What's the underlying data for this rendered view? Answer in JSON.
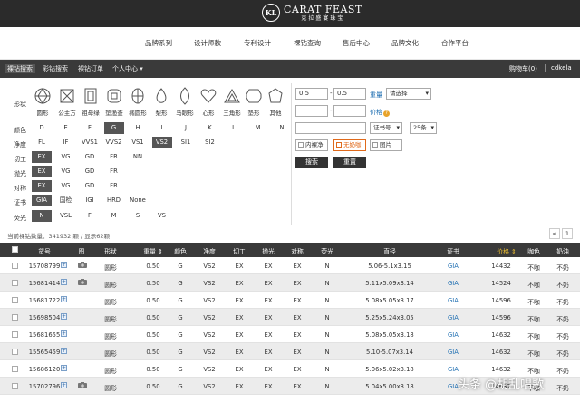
{
  "brand": {
    "name": "CARAT FEAST",
    "name_cn": "克拉盛宴珠宝",
    "mark": "KL"
  },
  "main_nav": [
    "品牌系列",
    "设计师款",
    "专利设计",
    "裸钻查询",
    "售后中心",
    "品牌文化",
    "合作平台"
  ],
  "sub_nav": {
    "items": [
      "裸钻搜索",
      "彩钻搜索",
      "裸钻订单",
      "个人中心 ▾"
    ],
    "active": 0,
    "cart": "购物车(0)",
    "user": "cdkela"
  },
  "filters": {
    "shape_label": "形状",
    "shapes": [
      "圆形",
      "公主方",
      "祖母绿",
      "垫渔查",
      "椭圆形",
      "梨形",
      "马眼形",
      "心形",
      "三角形",
      "垫形",
      "其他"
    ],
    "color_label": "颜色",
    "colors": [
      "D",
      "E",
      "F",
      "G",
      "H",
      "I",
      "J",
      "K",
      "L",
      "M",
      "N"
    ],
    "color_selected": "G",
    "clarity_label": "净度",
    "clarity": [
      "FL",
      "IF",
      "VVS1",
      "VVS2",
      "VS1",
      "VS2",
      "SI1",
      "SI2"
    ],
    "clarity_selected": "VS2",
    "cut_label": "切工",
    "cut": [
      "EX",
      "VG",
      "GD",
      "FR",
      "NN"
    ],
    "polish_label": "抛光",
    "polish": [
      "EX",
      "VG",
      "GD",
      "FR"
    ],
    "symmetry_label": "对称",
    "symmetry": [
      "EX",
      "VG",
      "GD",
      "FR"
    ],
    "cert_label": "证书",
    "cert": [
      "GIA",
      "国检",
      "IGI",
      "HRD",
      "None"
    ],
    "fluor_label": "荧光",
    "fluor": [
      "N",
      "VSL",
      "F",
      "M",
      "S",
      "VS"
    ]
  },
  "search": {
    "weight_min": "0.5",
    "weight_max": "0.5",
    "weight_label": "重量",
    "weight_select": "请选择",
    "price_min": "",
    "price_max": "",
    "price_label": "价格",
    "cert_no_value": "",
    "cert_no_select": "证书号",
    "per_page_select": "25条",
    "checkboxes": [
      {
        "label": "内裸净",
        "checked": false
      },
      {
        "label": "无奶咖",
        "checked": true
      },
      {
        "label": "图片",
        "checked": false
      }
    ],
    "search_button": "搜索",
    "reset_button": "重置"
  },
  "results": {
    "info": "当前裸钻数量：341932 颗 / 显示62颗",
    "pages": [
      "<",
      "1"
    ]
  },
  "table": {
    "headers": [
      "货号",
      "图",
      "形状",
      "重量 ⇕",
      "颜色",
      "净度",
      "切工",
      "抛光",
      "对称",
      "荧光",
      "直径",
      "证书",
      "价格 ⇕",
      "咖色",
      "奶油"
    ],
    "rows": [
      [
        "15708799",
        "圆形",
        "0.50",
        "G",
        "VS2",
        "EX",
        "EX",
        "EX",
        "N",
        "5.06-5.1x3.15",
        "GIA",
        "14432",
        "不咖",
        "不奶"
      ],
      [
        "15681414",
        "圆形",
        "0.50",
        "G",
        "VS2",
        "EX",
        "EX",
        "EX",
        "N",
        "5.11x5.09x3.14",
        "GIA",
        "14524",
        "不咖",
        "不奶"
      ],
      [
        "15681722",
        "圆形",
        "0.50",
        "G",
        "VS2",
        "EX",
        "EX",
        "EX",
        "N",
        "5.08x5.05x3.17",
        "GIA",
        "14596",
        "不咖",
        "不奶"
      ],
      [
        "15698504",
        "圆形",
        "0.50",
        "G",
        "VS2",
        "EX",
        "EX",
        "EX",
        "N",
        "5.25x5.24x3.05",
        "GIA",
        "14596",
        "不咖",
        "不奶"
      ],
      [
        "15681655",
        "圆形",
        "0.50",
        "G",
        "VS2",
        "EX",
        "EX",
        "EX",
        "N",
        "5.08x5.05x3.18",
        "GIA",
        "14632",
        "不咖",
        "不奶"
      ],
      [
        "15565459",
        "圆形",
        "0.50",
        "G",
        "VS2",
        "EX",
        "EX",
        "EX",
        "N",
        "5.10-5.07x3.14",
        "GIA",
        "14632",
        "不咖",
        "不奶"
      ],
      [
        "15686120",
        "圆形",
        "0.50",
        "G",
        "VS2",
        "EX",
        "EX",
        "EX",
        "N",
        "5.06x5.02x3.18",
        "GIA",
        "14632",
        "不咖",
        "不奶"
      ],
      [
        "15702796",
        "圆形",
        "0.50",
        "G",
        "VS2",
        "EX",
        "EX",
        "EX",
        "N",
        "5.04x5.00x3.18",
        "GIA",
        "14632",
        "不咖",
        "不奶"
      ]
    ],
    "row_has_photo": [
      true,
      true,
      false,
      false,
      false,
      false,
      false,
      true
    ]
  },
  "watermark": "头条 @胡乱唱歌",
  "colors": {
    "dark": "#2b2b2b",
    "link": "#1f6fb2",
    "accent_price": "#f0c030",
    "checked": "#e06a1b"
  }
}
